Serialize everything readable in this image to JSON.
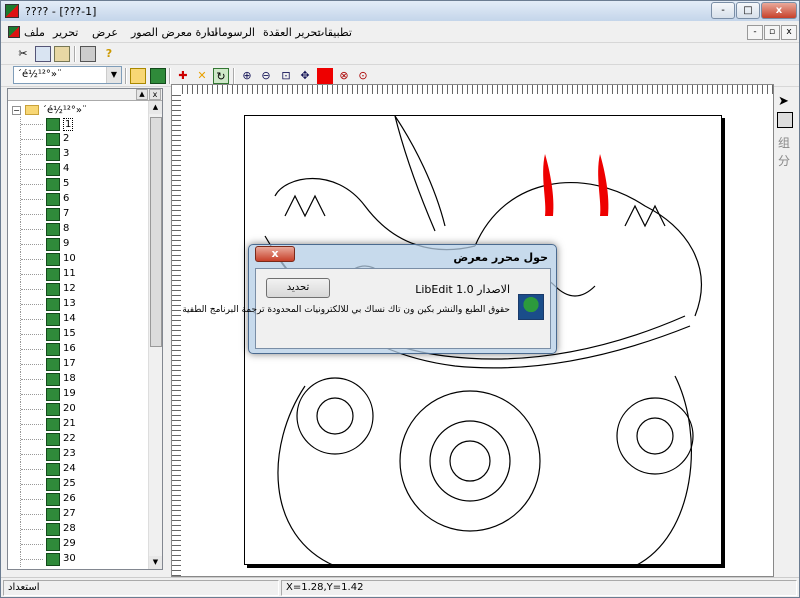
{
  "window": {
    "title": "???? - [???-1]",
    "controls": [
      "-",
      "□",
      "x"
    ]
  },
  "menubar": {
    "items": [
      {
        "id": "file",
        "label": "ملف"
      },
      {
        "id": "edit",
        "label": "تحرير"
      },
      {
        "id": "view",
        "label": "عرض"
      },
      {
        "id": "gallery",
        "label": "ادارة معرض الصور"
      },
      {
        "id": "drawings",
        "label": "الرسومات"
      },
      {
        "id": "edit-knot",
        "label": "تحرير العقدة"
      },
      {
        "id": "apps",
        "label": "تطبيقات"
      }
    ],
    "mdi_controls": [
      "-",
      "▫",
      "x"
    ]
  },
  "toolbar2": {
    "combo_value": "´é½¹²°»¨"
  },
  "tree": {
    "root_label": "´é½¹²°»¨",
    "selected": "1",
    "items": [
      "1",
      "2",
      "3",
      "4",
      "5",
      "6",
      "7",
      "8",
      "9",
      "10",
      "11",
      "12",
      "13",
      "14",
      "15",
      "16",
      "17",
      "18",
      "19",
      "20",
      "21",
      "22",
      "23",
      "24",
      "25",
      "26",
      "27",
      "28",
      "29",
      "30"
    ]
  },
  "right_panel": {
    "label_top": "组",
    "label_bottom": "分"
  },
  "dialog": {
    "title": "حول محرر معرض",
    "close": "x",
    "ok_label": "تحديد",
    "version": "الاصدار LibEdit 1.0",
    "copyright": "حقوق الطبع والنشر بكين ون تاك نساك بي للالكترونيات المحدودة ترجمة البرنامج الطفية"
  },
  "statusbar": {
    "ready": "استعداد",
    "coords": "X=1.28,Y=1.42"
  }
}
